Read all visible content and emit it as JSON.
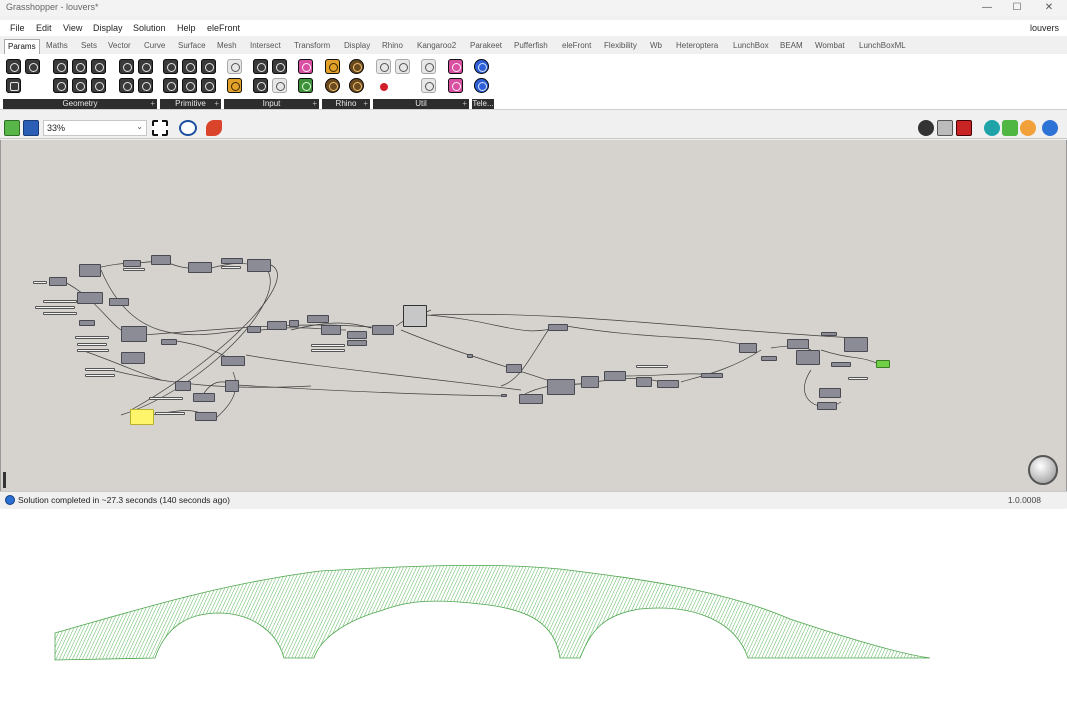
{
  "window": {
    "title": "Grasshopper - louvers*",
    "minimize_glyph": "—",
    "maximize_glyph": "☐",
    "close_glyph": "✕"
  },
  "menu": {
    "items": [
      "File",
      "Edit",
      "View",
      "Display",
      "Solution",
      "Help",
      "eleFront"
    ],
    "document_name": "louvers"
  },
  "tabs": [
    "Params",
    "Maths",
    "Sets",
    "Vector",
    "Curve",
    "Surface",
    "Mesh",
    "Intersect",
    "Transform",
    "Display",
    "Rhino",
    "Kangaroo2",
    "Parakeet",
    "Pufferfish",
    "eleFront",
    "Flexibility",
    "Wb",
    "Heteroptera",
    "LunchBox",
    "BEAM",
    "Wombat",
    "LunchBoxML"
  ],
  "active_tab": "Params",
  "ribbon_groups": [
    {
      "label": "Geometry",
      "icons": [
        "geometry-icon",
        "curve-icon",
        "circle-icon",
        "arc-icon",
        "box-icon",
        "brep-icon",
        "cancel-icon",
        "line-icon",
        "plane-icon",
        "point-icon",
        "surface-icon",
        "twisted-box-icon"
      ]
    },
    {
      "label": "Primitive",
      "icons": [
        "boolean-icon",
        "integer-icon",
        "number-icon",
        "data-icon",
        "domain-icon",
        "text-icon"
      ]
    },
    {
      "label": "Input",
      "icons": [
        "slider-icon",
        "toggle-icon",
        "value-list-icon",
        "gradient-icon",
        "button-icon",
        "panel-icon",
        "graph-icon",
        "swatch-icon"
      ]
    },
    {
      "label": "Rhino",
      "icons": [
        "hatch-icon",
        "hex-pattern-icon",
        "gear-icon",
        "honeycomb-icon"
      ]
    },
    {
      "label": "Util",
      "icons": [
        "vector-arrows-icon",
        "cluster-icon",
        "relay-icon",
        "cherry-icon",
        "jump-icon",
        "flask-icon",
        "contrast-icon"
      ]
    },
    {
      "label": "Tele...",
      "icons": [
        "hexagon-out-icon",
        "hexagon-in-icon"
      ]
    }
  ],
  "canvas_toolbar": {
    "zoom": "33%",
    "left_icons": [
      "open-folder-icon",
      "save-icon"
    ],
    "middle_icons": [
      "sketch-icon",
      "preview-eye-icon",
      "pen-icon"
    ],
    "right_icons": [
      "display-mesh-icon",
      "wireframe-icon",
      "shaded-icon",
      "teal-preview-icon",
      "green-preview-icon",
      "orange-preview-icon",
      "blue-sphere-icon"
    ]
  },
  "status": {
    "message": "Solution completed in ~27.3 seconds (140 seconds ago)",
    "version": "1.0.0008"
  },
  "colors": {
    "canvas_background": "#d6d3ce",
    "component_fill": "#8c8c96",
    "panel_yellow": "#fff56a",
    "output_green": "#6fcf45",
    "viewport_geometry": "#5cb85c"
  }
}
